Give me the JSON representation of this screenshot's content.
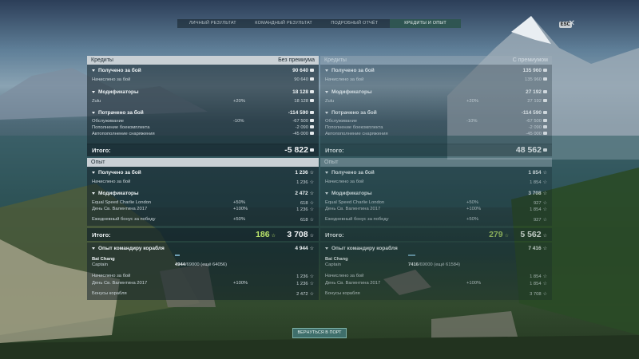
{
  "tabs": [
    {
      "label": "ЛИЧНЫЙ РЕЗУЛЬТАТ",
      "active": false
    },
    {
      "label": "КОМАНДНЫЙ РЕЗУЛЬТАТ",
      "active": false
    },
    {
      "label": "ПОДРОБНЫЙ ОТЧЁТ",
      "active": false
    },
    {
      "label": "КРЕДИТЫ И ОПЫТ",
      "active": true
    }
  ],
  "esc_label": "ESC",
  "close_glyph": "✕",
  "return_button": "ВЕРНУТЬСЯ В ПОРТ",
  "left": {
    "credits_header": "Кредиты",
    "credits_header_value": "Без премиума",
    "received": "Получено за бой",
    "received_value": "90 640",
    "earned": "Начислено за бой",
    "earned_value": "90 640",
    "modifiers": "Модификаторы",
    "modifiers_value": "18 128",
    "zulu": "Zulu",
    "zulu_pct": "+20%",
    "zulu_value": "18 128",
    "spent": "Потрачено за бой",
    "spent_value": "-114 590",
    "service": "Обслуживание",
    "service_pct": "-10%",
    "service_value": "-67 500",
    "ammo": "Пополнение боекомплекта",
    "ammo_value": "-2 090",
    "auto": "Автопополнение снаряжения",
    "auto_value": "-45 000",
    "total_label": "Итого:",
    "total_value": "-5 822",
    "xp_header": "Опыт",
    "xp_received": "Получено за бой",
    "xp_received_value": "1 236",
    "xp_earned": "Начислено за бой",
    "xp_earned_value": "1 236",
    "xp_modifiers": "Модификаторы",
    "xp_modifiers_value": "2 472",
    "charlie": "Equal Speed Charlie London",
    "charlie_pct": "+50%",
    "charlie_value": "618",
    "valentine": "День Св. Валентина 2017",
    "valentine_pct": "+100%",
    "valentine_value": "1 236",
    "daily": "Ежедневный бонус за победу",
    "daily_pct": "+50%",
    "daily_value": "618",
    "xp_total_label": "Итого:",
    "xp_total_free": "186",
    "xp_total_value": "3 708",
    "cmd": "Опыт командиру корабля",
    "cmd_value": "4 944",
    "cmd_name": "Bai Chang",
    "cmd_rank": "Captain",
    "cmd_progress": "4944",
    "cmd_progress_max": "/69000",
    "cmd_remaining": "(ещё 64056)",
    "cmd_earned": "Начислено за бой",
    "cmd_earned_value": "1 236",
    "cmd_valentine": "День Св. Валентина 2017",
    "cmd_valentine_pct": "+100%",
    "cmd_valentine_value": "1 236",
    "ship_bonus": "Бонусы корабля",
    "ship_bonus_value": "2 472"
  },
  "right": {
    "credits_header": "Кредиты",
    "credits_header_value": "С премиумом",
    "received": "Получено за бой",
    "received_value": "135 960",
    "earned": "Начислено за бой",
    "earned_value": "135 960",
    "modifiers": "Модификаторы",
    "modifiers_value": "27 192",
    "zulu": "Zulu",
    "zulu_pct": "+20%",
    "zulu_value": "27 192",
    "spent": "Потрачено за бой",
    "spent_value": "-114 590",
    "service": "Обслуживание",
    "service_pct": "-10%",
    "service_value": "-67 500",
    "ammo": "Пополнение боекомплекта",
    "ammo_value": "-2 090",
    "auto": "Автопополнение снаряжения",
    "auto_value": "-45 000",
    "total_label": "Итого:",
    "total_value": "48 562",
    "xp_header": "Опыт",
    "xp_received": "Получено за бой",
    "xp_received_value": "1 854",
    "xp_earned": "Начислено за бой",
    "xp_earned_value": "1 854",
    "xp_modifiers": "Модификаторы",
    "xp_modifiers_value": "3 708",
    "charlie": "Equal Speed Charlie London",
    "charlie_pct": "+50%",
    "charlie_value": "927",
    "valentine": "День Св. Валентина 2017",
    "valentine_pct": "+100%",
    "valentine_value": "1 854",
    "daily": "Ежедневный бонус за победу",
    "daily_pct": "+50%",
    "daily_value": "927",
    "xp_total_label": "Итого:",
    "xp_total_free": "279",
    "xp_total_value": "5 562",
    "cmd": "Опыт командиру корабля",
    "cmd_value": "7 416",
    "cmd_name": "Bai Chang",
    "cmd_rank": "Captain",
    "cmd_progress": "7416",
    "cmd_progress_max": "/69000",
    "cmd_remaining": "(ещё 61584)",
    "cmd_earned": "Начислено за бой",
    "cmd_earned_value": "1 854",
    "cmd_valentine": "День Св. Валентина 2017",
    "cmd_valentine_pct": "+100%",
    "cmd_valentine_value": "1 854",
    "ship_bonus": "Бонусы корабля",
    "ship_bonus_value": "3 708"
  }
}
